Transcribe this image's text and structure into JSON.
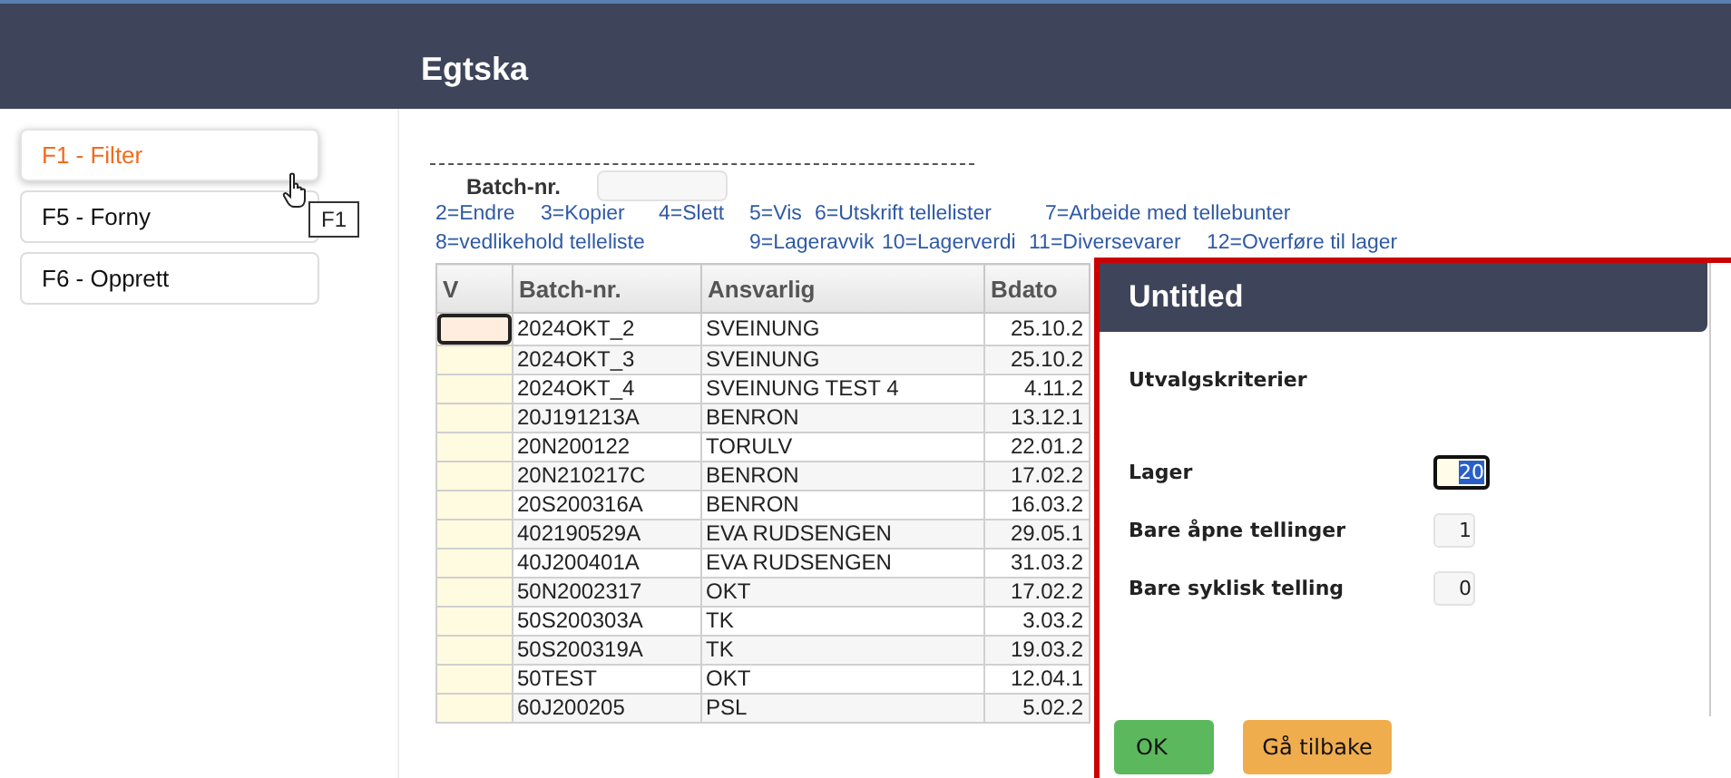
{
  "header": {
    "title": "Egtska"
  },
  "sidebar": {
    "items": [
      {
        "label": "F1 - Filter",
        "selected": true
      },
      {
        "label": "F5 - Forny",
        "selected": false
      },
      {
        "label": "F6 - Opprett",
        "selected": false
      }
    ],
    "tooltip": "F1"
  },
  "filter": {
    "label": "Batch-nr."
  },
  "commands": [
    [
      "2=Endre",
      "3=Kopier",
      "4=Slett",
      "5=Vis",
      "6=Utskrift tellelister",
      "7=Arbeide med tellebunter"
    ],
    [
      "8=vedlikehold telleliste",
      "9=Lageravvik",
      "10=Lagerverdi",
      "11=Diversevarer",
      "12=Overføre til lager"
    ]
  ],
  "table": {
    "columns": [
      "V",
      "Batch-nr.",
      "Ansvarlig",
      "Bdato"
    ],
    "rows": [
      {
        "batch": "2024OKT_2",
        "ansvarlig": "SVEINUNG",
        "bdato": "25.10.2",
        "focused": true
      },
      {
        "batch": "2024OKT_3",
        "ansvarlig": "SVEINUNG",
        "bdato": "25.10.2",
        "focused": false
      },
      {
        "batch": "2024OKT_4",
        "ansvarlig": "SVEINUNG TEST 4",
        "bdato": "4.11.2",
        "focused": false
      },
      {
        "batch": "20J191213A",
        "ansvarlig": "BENRON",
        "bdato": "13.12.1",
        "focused": false
      },
      {
        "batch": "20N200122",
        "ansvarlig": "TORULV",
        "bdato": "22.01.2",
        "focused": false
      },
      {
        "batch": "20N210217C",
        "ansvarlig": "BENRON",
        "bdato": "17.02.2",
        "focused": false
      },
      {
        "batch": "20S200316A",
        "ansvarlig": "BENRON",
        "bdato": "16.03.2",
        "focused": false
      },
      {
        "batch": "402190529A",
        "ansvarlig": "EVA RUDSENGEN",
        "bdato": "29.05.1",
        "focused": false
      },
      {
        "batch": "40J200401A",
        "ansvarlig": "EVA RUDSENGEN",
        "bdato": "31.03.2",
        "focused": false
      },
      {
        "batch": "50N2002317",
        "ansvarlig": "OKT",
        "bdato": "17.02.2",
        "focused": false
      },
      {
        "batch": "50S200303A",
        "ansvarlig": "TK",
        "bdato": "3.03.2",
        "focused": false
      },
      {
        "batch": "50S200319A",
        "ansvarlig": "TK",
        "bdato": "19.03.2",
        "focused": false
      },
      {
        "batch": "50TEST",
        "ansvarlig": "OKT",
        "bdato": "12.04.1",
        "focused": false
      },
      {
        "batch": "60J200205",
        "ansvarlig": "PSL",
        "bdato": "5.02.2",
        "focused": false
      }
    ]
  },
  "dialog": {
    "title": "Untitled",
    "heading": "Utvalgskriterier",
    "fields": [
      {
        "label": "Lager",
        "value": "20",
        "focused": true
      },
      {
        "label": "Bare åpne tellinger",
        "value": "1",
        "focused": false
      },
      {
        "label": "Bare syklisk telling",
        "value": "0",
        "focused": false
      }
    ],
    "buttons": [
      {
        "label": "OK",
        "kind": "primary"
      },
      {
        "label": "Gå tilbake",
        "kind": "secondary"
      }
    ]
  }
}
